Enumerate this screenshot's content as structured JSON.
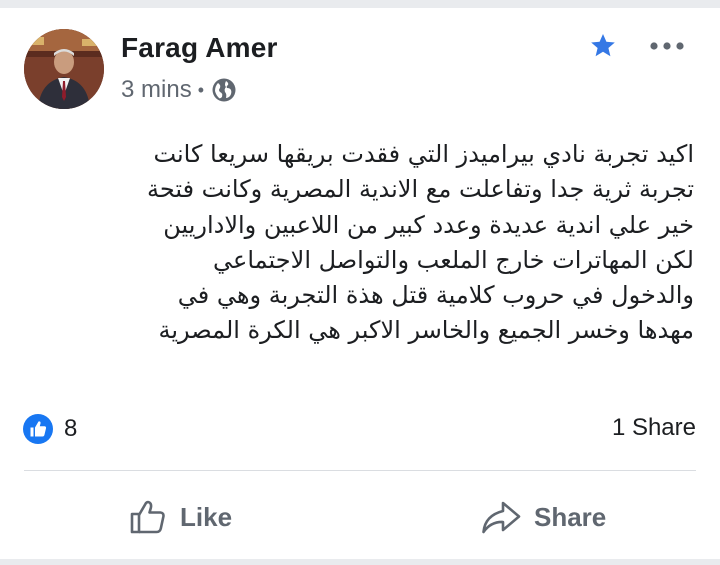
{
  "post": {
    "author": "Farag Amer",
    "timestamp": "3 mins",
    "meta_separator": "•",
    "privacy_icon": "globe-icon",
    "body_lines": [
      "اكيد تجربة نادي بيراميدز التي فقدت بريقها سريعا كانت",
      "تجربة ثرية جدا وتفاعلت مع الاندية المصرية وكانت فتحة",
      "خير علي اندية عديدة وعدد كبير  من اللاعبين والاداريين",
      "لكن المهاترات  خارج الملعب والتواصل الاجتماعي",
      "والدخول في حروب  كلامية قتل  هذة التجربة وهي في",
      "مهدها وخسر الجميع والخاسر الاكبر هي الكرة المصرية"
    ],
    "reaction_icon": "like-reaction-icon",
    "reaction_count": "8",
    "share_count": "1 Share"
  },
  "actions": {
    "like_label": "Like",
    "share_label": "Share"
  },
  "colors": {
    "accent": "#1877f2",
    "star": "#3578e5",
    "muted_text": "#606770",
    "text": "#1c1e21",
    "divider": "#dadde1"
  }
}
